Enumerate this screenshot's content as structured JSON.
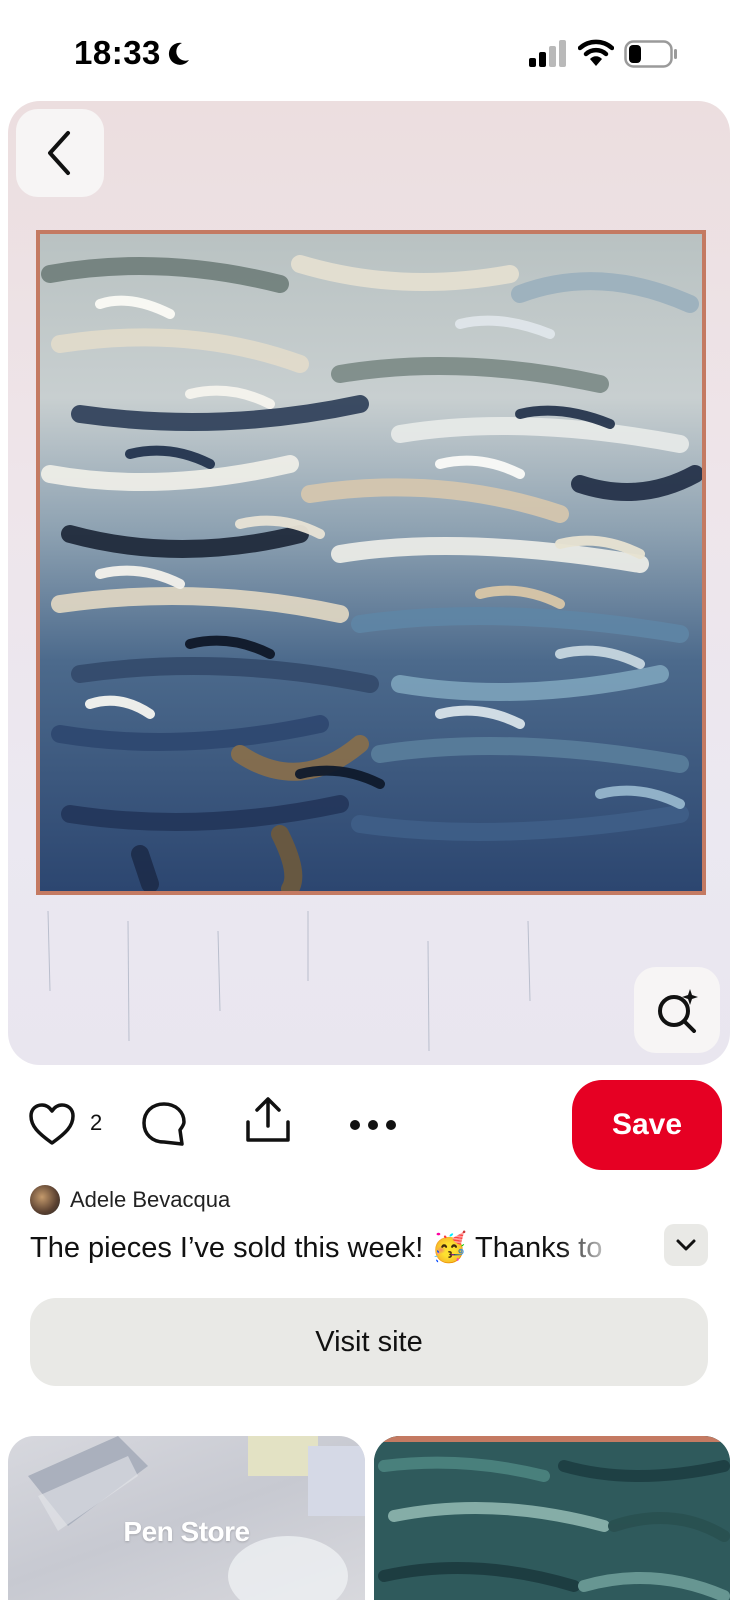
{
  "status_bar": {
    "time": "18:33",
    "icons": [
      "moon-icon",
      "signal-icon",
      "wifi-icon",
      "battery-icon"
    ]
  },
  "pin": {
    "image_description_icon": "painting-image",
    "back_icon": "chevron-left-icon",
    "visual_search_icon": "lens-sparkle-icon"
  },
  "actions": {
    "like_count": "2",
    "save_label": "Save",
    "icons": [
      "heart-icon",
      "comment-icon",
      "share-icon",
      "more-icon"
    ]
  },
  "author": {
    "name": "Adele Bevacqua"
  },
  "description": {
    "text": "The pieces I’ve sold this week! 🥳 Thanks to"
  },
  "visit_site_label": "Visit site",
  "related": {
    "cards": [
      {
        "label": "Pen Store"
      },
      {
        "label": ""
      }
    ]
  },
  "colors": {
    "save_red": "#e60023",
    "button_gray": "#e9e9e6",
    "frame_wood": "#c47a62"
  }
}
